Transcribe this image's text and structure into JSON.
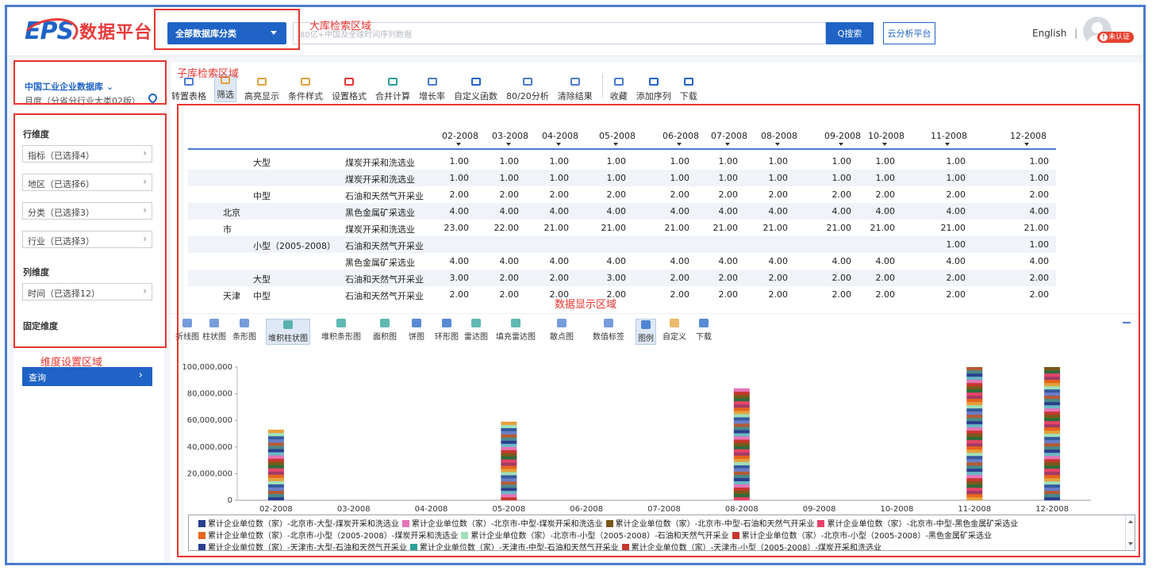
{
  "header": {
    "logo_text": "EPS",
    "platform_title": "数据平台",
    "db_category_label": "全部数据库分类",
    "search_placeholder": "80亿+中国及全球时间序列数据",
    "search_button": "Q搜索",
    "cloud_button": "云分析平台",
    "language": "English",
    "separator": "|",
    "unauth_badge": "未认证"
  },
  "annotations": {
    "main_search": "大库检索区域",
    "sub_search": "子库检索区域",
    "data_display": "数据显示区域",
    "dimension_settings": "维度设置区域"
  },
  "sidebar": {
    "db_name": "中国工业企业数据库 ⌄",
    "db_subtitle": "月度（分省分行业大类02版）",
    "row_dim_title": "行维度",
    "row_dims": [
      "指标（已选择4）",
      "地区（已选择6）",
      "分类（已选择3）",
      "行业（已选择3）"
    ],
    "col_dim_title": "列维度",
    "col_dims": [
      "时间（已选择12）"
    ],
    "fixed_dim_title": "固定维度",
    "query_button": "查询",
    "query_arrow": "›"
  },
  "toolbar": {
    "items": [
      "转置表格",
      "筛选",
      "高亮显示",
      "条件样式",
      "设置格式",
      "合并计算",
      "增长率",
      "自定义函数",
      "80/20分析",
      "清除结果",
      "收藏",
      "添加序列",
      "下载"
    ],
    "icon_colors": [
      "#4a7bd0",
      "#e6a23c",
      "#e6a23c",
      "#e6a23c",
      "#e9342f",
      "#2aa198",
      "#4a7bd0",
      "#1f63c6",
      "#4a7bd0",
      "#4a7bd0",
      "#4a7bd0",
      "#1f63c6",
      "#1f63c6"
    ]
  },
  "table": {
    "columns": [
      "02-2008",
      "03-2008",
      "04-2008",
      "05-2008",
      "06-2008",
      "07-2008",
      "08-2008",
      "09-2008",
      "10-2008",
      "11-2008",
      "12-2008"
    ],
    "rows": [
      {
        "region": "",
        "size": "大型",
        "industry": "煤炭开采和洗选业",
        "values": [
          "1.00",
          "1.00",
          "1.00",
          "1.00",
          "1.00",
          "1.00",
          "1.00",
          "1.00",
          "1.00",
          "1.00",
          "1.00"
        ]
      },
      {
        "region": "",
        "size": "",
        "industry": "煤炭开采和洗选业",
        "values": [
          "1.00",
          "1.00",
          "1.00",
          "1.00",
          "1.00",
          "1.00",
          "1.00",
          "1.00",
          "1.00",
          "1.00",
          "1.00"
        ]
      },
      {
        "region": "",
        "size": "中型",
        "industry": "石油和天然气开采业",
        "values": [
          "2.00",
          "2.00",
          "2.00",
          "2.00",
          "2.00",
          "2.00",
          "2.00",
          "2.00",
          "2.00",
          "2.00",
          "2.00"
        ]
      },
      {
        "region": "北京",
        "size": "",
        "industry": "黑色金属矿采选业",
        "values": [
          "4.00",
          "4.00",
          "4.00",
          "4.00",
          "4.00",
          "4.00",
          "4.00",
          "4.00",
          "4.00",
          "4.00",
          "4.00"
        ]
      },
      {
        "region": "市",
        "size": "",
        "industry": "煤炭开采和洗选业",
        "values": [
          "23.00",
          "22.00",
          "21.00",
          "21.00",
          "21.00",
          "21.00",
          "21.00",
          "21.00",
          "21.00",
          "21.00",
          "21.00"
        ]
      },
      {
        "region": "",
        "size": "小型（2005-2008）",
        "industry": "石油和天然气开采业",
        "values": [
          "",
          "",
          "",
          "",
          "",
          "",
          "",
          "",
          "",
          "1.00",
          "1.00"
        ]
      },
      {
        "region": "",
        "size": "",
        "industry": "黑色金属矿采选业",
        "values": [
          "4.00",
          "4.00",
          "4.00",
          "4.00",
          "4.00",
          "4.00",
          "4.00",
          "4.00",
          "4.00",
          "4.00",
          "4.00"
        ]
      },
      {
        "region": "",
        "size": "大型",
        "industry": "石油和天然气开采业",
        "values": [
          "3.00",
          "2.00",
          "2.00",
          "3.00",
          "2.00",
          "2.00",
          "2.00",
          "2.00",
          "2.00",
          "2.00",
          "2.00"
        ]
      },
      {
        "region": "天津",
        "size": "中型",
        "industry": "石油和天然气开采业",
        "values": [
          "2.00",
          "2.00",
          "2.00",
          "2.00",
          "2.00",
          "2.00",
          "2.00",
          "2.00",
          "2.00",
          "2.00",
          "2.00"
        ]
      }
    ]
  },
  "chart_toolbar": {
    "items": [
      "折线图",
      "柱状图",
      "条形图",
      "堆积柱状图",
      "堆积条形图",
      "面积图",
      "饼图",
      "环形图",
      "雷达图",
      "填充雷达图",
      "散点图",
      "数值标签",
      "图例",
      "自定义",
      "下载"
    ],
    "icon_colors": [
      "#4a7bd0",
      "#4a7bd0",
      "#4a7bd0",
      "#2aa198",
      "#2aa198",
      "#2aa198",
      "#1f63c6",
      "#1f63c6",
      "#2aa198",
      "#2aa198",
      "#4a7bd0",
      "#4a7bd0",
      "#1f63c6",
      "#e6a23c",
      "#1f63c6"
    ]
  },
  "chart_data": {
    "type": "bar",
    "stacked": true,
    "categories": [
      "02-2008",
      "03-2008",
      "04-2008",
      "05-2008",
      "06-2008",
      "07-2008",
      "08-2008",
      "09-2008",
      "10-2008",
      "11-2008",
      "12-2008"
    ],
    "totals": [
      53000000,
      0,
      0,
      59000000,
      0,
      0,
      84000000,
      0,
      0,
      100000000,
      100000000
    ],
    "ylim": [
      0,
      100000000
    ],
    "yticks": [
      "100,000,000",
      "80,000,000",
      "60,000,000",
      "40,000,000",
      "20,000,000",
      "0"
    ],
    "series_colors": [
      "#2a3f8f",
      "#e673b8",
      "#7a5a1a",
      "#e8436a",
      "#e7651b",
      "#9fe0b8",
      "#6a7ec8",
      "#4a8a8a",
      "#6bb7c4",
      "#c7372f",
      "#2f6b3a",
      "#a23a66",
      "#e5a03a",
      "#355a9e",
      "#b45a34"
    ],
    "legend_entries": [
      "累计企业单位数（家）-北京市-大型-煤炭开采和洗选业",
      "累计企业单位数（家）-北京市-中型-煤炭开采和洗选业",
      "累计企业单位数（家）-北京市-中型-石油和天然气开采业",
      "累计企业单位数（家）-北京市-中型-黑色金属矿采选业",
      "累计企业单位数（家）-北京市-小型（2005-2008）-煤炭开采和洗选业",
      "累计企业单位数（家）-北京市-小型（2005-2008）-石油和天然气开采业",
      "累计企业单位数（家）-北京市-小型（2005-2008）-黑色金属矿采选业",
      "累计企业单位数（家）-天津市-大型-石油和天然气开采业",
      "累计企业单位数（家）-天津市-中型-石油和天然气开采业",
      "累计企业单位数（家）-天津市-小型（2005-2008）-煤炭开采和洗选业"
    ],
    "legend_colors": [
      "#2a3f8f",
      "#e673b8",
      "#7a5a1a",
      "#e8436a",
      "#e7651b",
      "#9fe0b8",
      "#c7372f",
      "#2a3f8f",
      "#2aa198",
      "#c7372f"
    ]
  }
}
